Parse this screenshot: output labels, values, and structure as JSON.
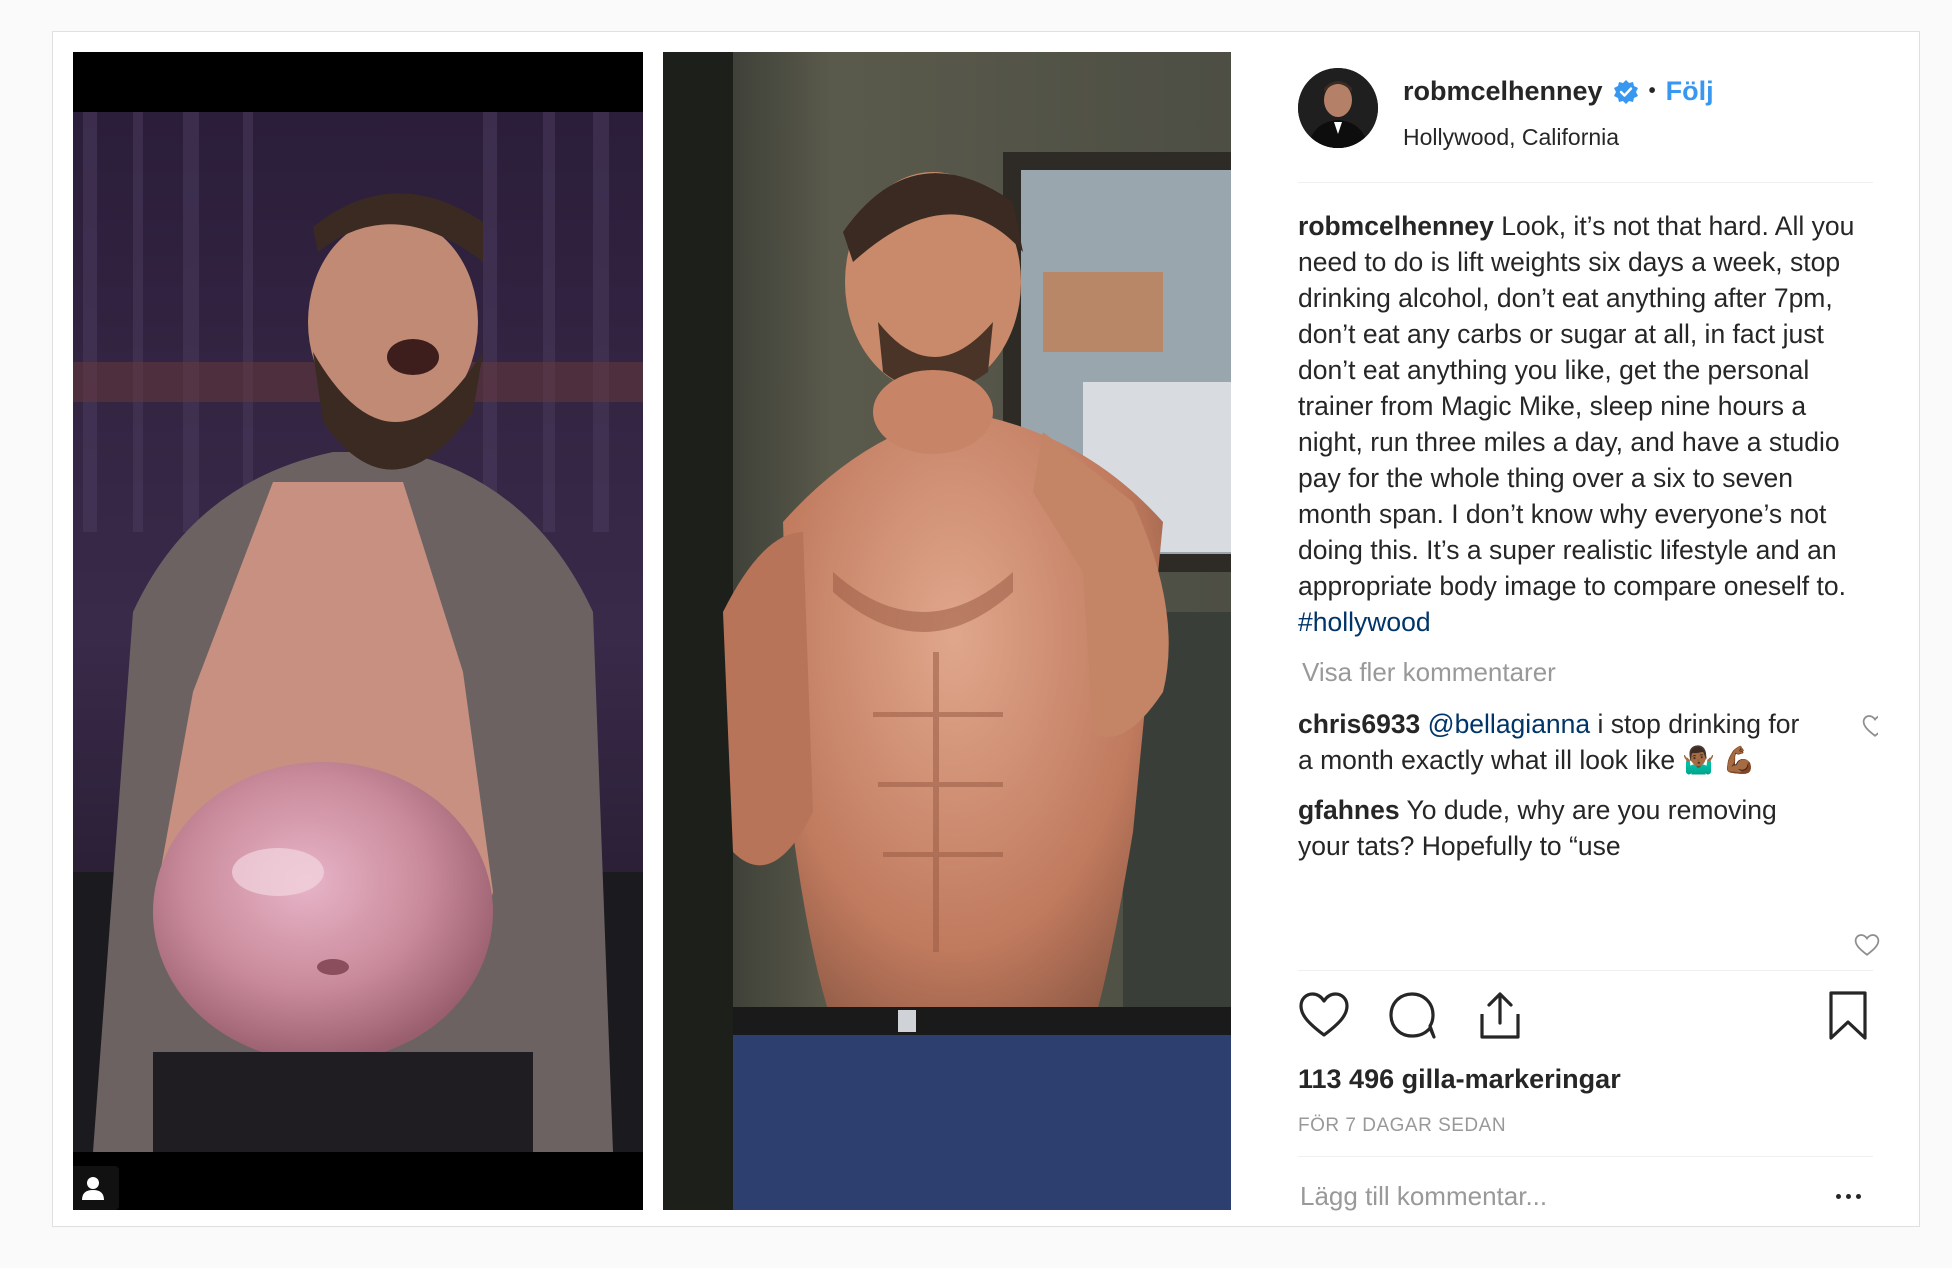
{
  "post": {
    "username": "robmcelhenney",
    "follow_label": "Följ",
    "separator": "•",
    "location": "Hollywood, California",
    "caption_username": "robmcelhenney",
    "caption_text": " Look, it’s not that hard. All you need to do is lift weights six days a week, stop drinking alcohol, don’t eat anything after 7pm, don’t eat any carbs or sugar at all, in fact just don’t eat anything you like, get the personal trainer from Magic Mike, sleep nine hours a night, run three miles a day, and have a studio pay for the whole thing over a six to seven month span. I don’t know why everyone’s not doing this. It’s a super realistic lifestyle and an appropriate body image to compare oneself to. ",
    "caption_hashtag": "#hollywood",
    "view_more_comments": "Visa fler kommentarer",
    "comments": [
      {
        "username": "chris6933",
        "mention": "@bellagianna",
        "text": " i stop drinking for a month exactly what ill look like 🤷🏾‍♂️ 💪🏾"
      },
      {
        "username": "gfahnes",
        "mention": "",
        "text": " Yo dude, why are you removing your tats? Hopefully to “use"
      }
    ],
    "likes_text": "113 496 gilla-markeringar",
    "timestamp": "FÖR 7 DAGAR SEDAN",
    "add_comment_placeholder": "Lägg till kommentar..."
  },
  "icons": {
    "verified": "verified-badge-icon",
    "like": "heart-icon",
    "comment": "comment-bubble-icon",
    "share": "share-icon",
    "save": "bookmark-icon",
    "more": "more-options-icon",
    "user_tag": "user-tag-icon"
  },
  "colors": {
    "link_blue": "#3897f0",
    "hashtag_blue": "#003569",
    "text": "#262626",
    "muted": "#999999"
  }
}
